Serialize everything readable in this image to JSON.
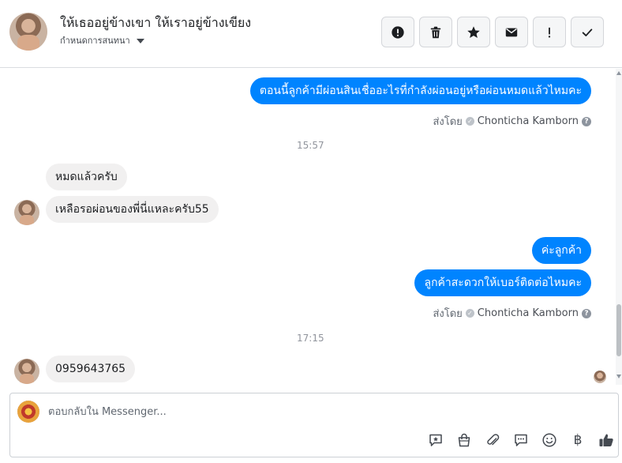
{
  "header": {
    "title": "ให้เธออยู่ข้างเขา ให้เราอยู่ข้างเขียง",
    "subtitle": "กำหนดการสนทนา",
    "actions": [
      {
        "name": "report",
        "icon": "alert-circle-icon"
      },
      {
        "name": "delete",
        "icon": "trash-icon"
      },
      {
        "name": "star",
        "icon": "star-icon"
      },
      {
        "name": "mark-unread",
        "icon": "envelope-icon"
      },
      {
        "name": "follow-up",
        "icon": "exclamation-icon"
      },
      {
        "name": "done",
        "icon": "check-icon"
      }
    ]
  },
  "messages": {
    "m1": "ตอนนี้ลูกค้ามีผ่อนสินเชื่ออะไรที่กำลังผ่อนอยู่หรือผ่อนหมดแล้วไหมคะ",
    "sent_by_label_1": "ส่งโดย",
    "sender_1": "Chonticha Kamborn",
    "time_1": "15:57",
    "m2": "หมดแล้วครับ",
    "m3": "เหลือรอผ่อนของพี่นี่แหละครับ55",
    "m4": "ค่ะลูกค้า",
    "m5": "ลูกค้าสะดวกให้เบอร์ติดต่อไหมคะ",
    "sent_by_label_2": "ส่งโดย",
    "sender_2": "Chonticha Kamborn",
    "time_2": "17:15",
    "m6": "0959643765"
  },
  "composer": {
    "placeholder": "ตอบกลับใน Messenger...",
    "tools": [
      "saved-reply-icon",
      "shop-bag-icon",
      "paperclip-icon",
      "chat-bubble-icon",
      "emoji-icon",
      "baht-icon",
      "thumbs-up-icon"
    ],
    "baht_symbol": "฿"
  },
  "colors": {
    "outgoing_bubble": "#0084ff",
    "incoming_bubble": "#f1f0f0",
    "like_button": "#444950"
  }
}
